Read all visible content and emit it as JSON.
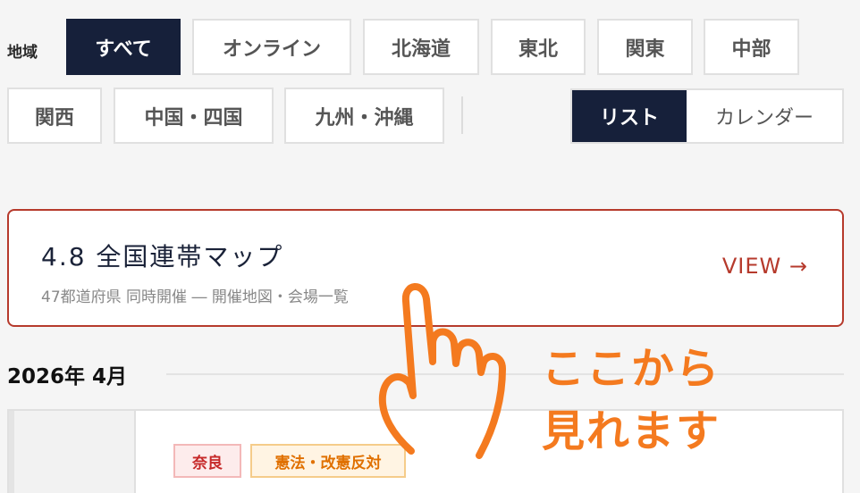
{
  "filters": {
    "region_label": "地域",
    "regions": [
      {
        "label": "すべて",
        "active": true
      },
      {
        "label": "オンライン",
        "active": false
      },
      {
        "label": "北海道",
        "active": false
      },
      {
        "label": "東北",
        "active": false
      },
      {
        "label": "関東",
        "active": false
      },
      {
        "label": "中部",
        "active": false
      },
      {
        "label": "関西",
        "active": false
      },
      {
        "label": "中国・四国",
        "active": false
      },
      {
        "label": "九州・沖縄",
        "active": false
      }
    ]
  },
  "view_toggle": {
    "list_label": "リスト",
    "calendar_label": "カレンダー",
    "selected": "list"
  },
  "map_card": {
    "title": "4.8 全国連帯マップ",
    "subtitle": "47都道府県 同時開催 ― 開催地図・会場一覧",
    "view_label": "VIEW →"
  },
  "month_heading": "2026年 4月",
  "event": {
    "tags": [
      "奈良",
      "憲法・改憲反対"
    ]
  },
  "annotation": {
    "line1": "ここから",
    "line2": "見れます"
  },
  "colors": {
    "navy": "#16203a",
    "accent_red": "#b63a2c",
    "annotation_orange": "#f47a1f"
  }
}
